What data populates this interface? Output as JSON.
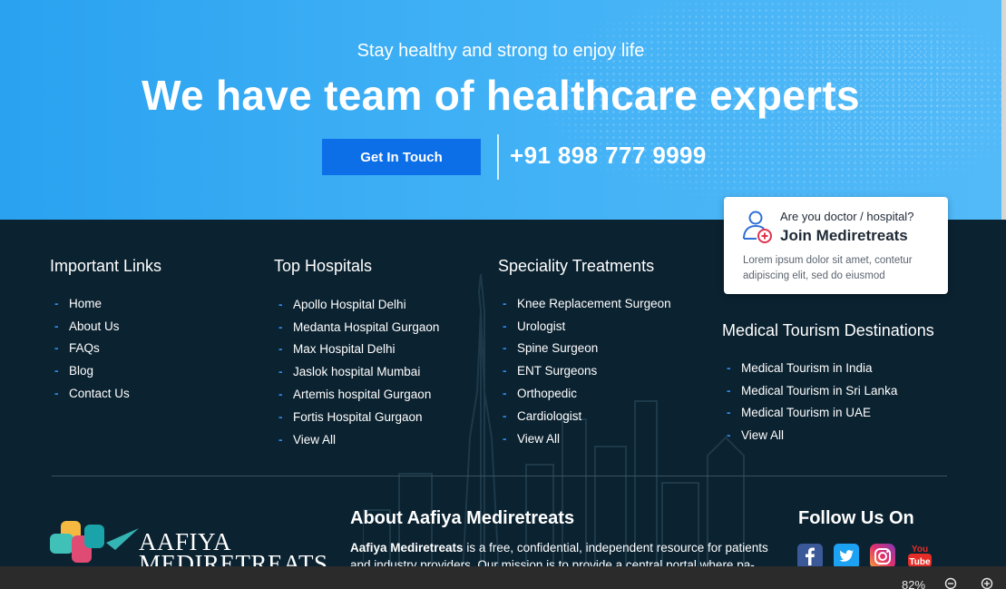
{
  "hero": {
    "subtitle": "Stay healthy and strong to enjoy life",
    "title": "We have team of healthcare experts",
    "cta_label": "Get In Touch",
    "phone": "+91 898 777 9999"
  },
  "columns": [
    {
      "heading": "Important Links",
      "items": [
        "Home",
        "About Us",
        "FAQs",
        "Blog",
        "Contact Us"
      ]
    },
    {
      "heading": "Top Hospitals",
      "items": [
        "Apollo Hospital Delhi",
        "Medanta Hospital Gurgaon",
        "Max Hospital Delhi",
        "Jaslok hospital Mumbai",
        "Artemis hospital Gurgaon",
        "Fortis Hospital Gurgaon",
        "View All"
      ]
    },
    {
      "heading": "Speciality Treatments",
      "items": [
        "Knee Replacement Surgeon",
        "Urologist",
        "Spine Surgeon",
        "ENT Surgeons",
        "Orthopedic",
        "Cardiologist",
        "View All"
      ]
    },
    {
      "heading": "Medical Tourism Destinations",
      "items": [
        "Medical Tourism in India",
        "Medical Tourism in Sri Lanka",
        "Medical Tourism in UAE",
        "View All"
      ]
    }
  ],
  "join_card": {
    "question": "Are you doctor / hospital?",
    "heading": "Join Mediretreats",
    "text": "Lorem ipsum dolor sit amet, contetur adipiscing elit, sed do eiusmod"
  },
  "logo": {
    "line1": "AAFIYA",
    "line2": "MEDIRETREATS"
  },
  "about": {
    "heading": "About Aafiya Mediretreats",
    "brand": "Aafiya Mediretreats",
    "text": " is a free, confidential, independent resource for patients and industry providers. Our mission is to provide a central portal where pa-"
  },
  "follow": {
    "heading": "Follow Us On",
    "icons": [
      "facebook-icon",
      "twitter-icon",
      "instagram-icon",
      "youtube-icon"
    ],
    "youtube_you": "You",
    "youtube_tube": "Tube"
  },
  "viewer": {
    "zoom": "82%"
  },
  "colors": {
    "accent": "#0d6fe8",
    "dash": "#2f8cf0",
    "footer_bg": "#0b2230",
    "hero_bg": "#3fb0f5"
  }
}
